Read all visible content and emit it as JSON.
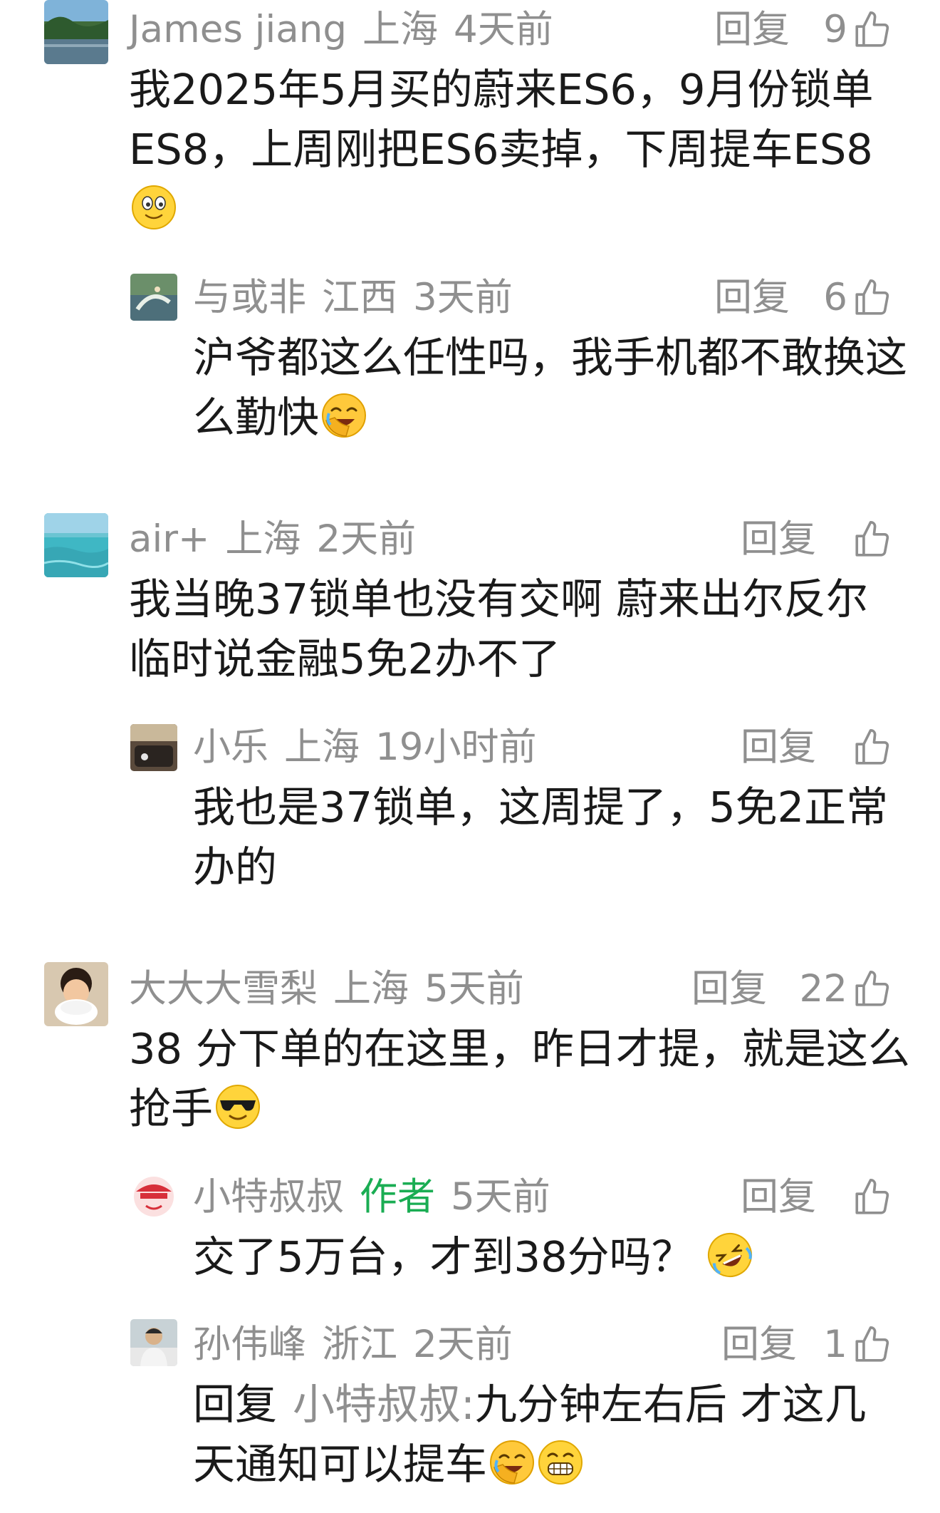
{
  "ui": {
    "reply_label": "回复",
    "author_tag": "作者"
  },
  "comments": [
    {
      "user": "James jiang",
      "location": "上海",
      "time": "4天前",
      "likes": "9",
      "lines": [
        "我2025年5月买的蔚来ES6，9月份锁单",
        "ES8，上周刚把ES6卖掉，下周提车ES8",
        ""
      ],
      "emoji": "smile-emoji",
      "avatar": "scenery-lake-avatar"
    },
    {
      "user": "与或非",
      "location": "江西",
      "time": "3天前",
      "likes": "6",
      "lines": [
        "沪爷都这么任性吗，我手机都不敢换这",
        "么勤快"
      ],
      "emoji": "facepalm-laugh-emoji",
      "avatar": "surfing-avatar"
    },
    {
      "user": "air+",
      "location": "上海",
      "time": "2天前",
      "likes": "",
      "lines": [
        "我当晚37锁单也没有交啊 蔚来出尔反尔",
        "临时说金融5免2办不了"
      ],
      "avatar": "sea-avatar"
    },
    {
      "user": "小乐",
      "location": "上海",
      "time": "19小时前",
      "likes": "",
      "lines": [
        "我也是37锁单，这周提了，5免2正常",
        "办的"
      ],
      "avatar": "car-interior-avatar"
    },
    {
      "user": "大大大雪梨",
      "location": "上海",
      "time": "5天前",
      "likes": "22",
      "lines": [
        "38 分下单的在这里，昨日才提，就是这么",
        "抢手"
      ],
      "emoji": "sunglasses-emoji",
      "avatar": "child-eating-avatar"
    },
    {
      "user": "小特叔叔",
      "location": "",
      "time": "5天前",
      "likes": "",
      "lines": [
        "交了5万台，才到38分吗？"
      ],
      "emoji": "rofl-emoji",
      "avatar": "cartoon-face-avatar"
    },
    {
      "user": "孙伟峰",
      "location": "浙江",
      "time": "2天前",
      "likes": "1",
      "reply_to": "小特叔叔:",
      "lines": [
        "九分钟左右后 才这几",
        "天通知可以提车"
      ],
      "emoji": "facepalm-laugh-emoji",
      "emoji2": "grin-emoji",
      "avatar": "man-portrait-avatar"
    }
  ],
  "colors": {
    "meta_gray": "#8f8f8f",
    "author_green": "#1aad53",
    "text": "#1a1a1a"
  }
}
